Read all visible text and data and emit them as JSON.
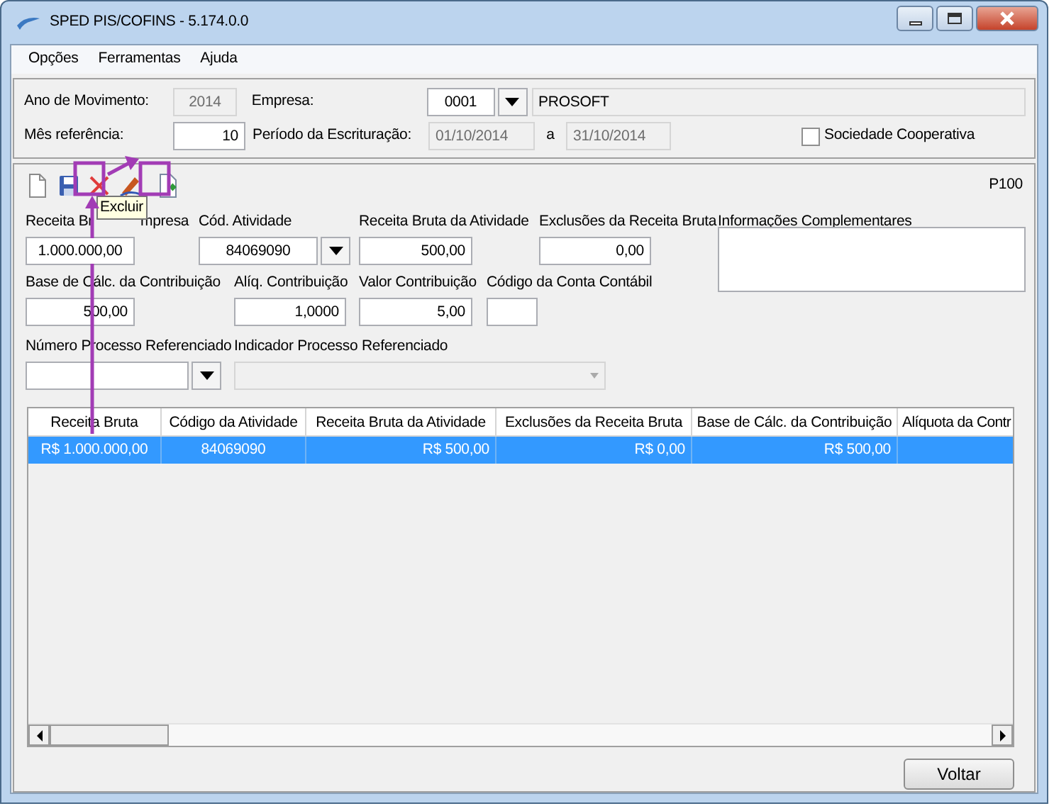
{
  "window": {
    "title": "SPED PIS/COFINS - 5.174.0.0"
  },
  "menu": [
    "Opções",
    "Ferramentas",
    "Ajuda"
  ],
  "header": {
    "ano_label": "Ano de Movimento:",
    "ano": "2014",
    "empresa_label": "Empresa:",
    "empresa_code": "0001",
    "empresa_name": "PROSOFT",
    "mes_label": "Mês referência:",
    "mes": "10",
    "periodo_label": "Período da Escrituração:",
    "periodo_inicio": "01/10/2014",
    "periodo_sep": "a",
    "periodo_fim": "31/10/2014",
    "cooperativa": {
      "label": "Sociedade Cooperativa",
      "checked": false
    }
  },
  "toolbar": {
    "register": "P100",
    "tooltip": "Excluir"
  },
  "form": {
    "rows": [
      [
        {
          "kind": "text",
          "label": "Receita Br",
          "label_tail": "mpresa",
          "value": "1.000.000,00"
        },
        {
          "kind": "combo",
          "label": "Cód. Atividade",
          "value": "84069090"
        },
        {
          "kind": "text",
          "label": "Receita Bruta da Atividade",
          "value": "500,00"
        },
        {
          "kind": "text",
          "label": "Exclusões da Receita Bruta",
          "value": "0,00"
        }
      ],
      [
        {
          "kind": "text",
          "label": "Base de Cálc. da Contribuição",
          "value": "500,00"
        },
        {
          "kind": "text",
          "label": "Alíq. Contribuição",
          "value": "1,0000"
        },
        {
          "kind": "text",
          "label": "Valor Contribuição",
          "value": "5,00"
        },
        {
          "kind": "text",
          "label": "Código da Conta Contábil"
        }
      ],
      [
        {
          "kind": "combo",
          "label": "Número Processo Referenciado"
        },
        {
          "kind": "combo",
          "label": "Indicador Processo Referenciado",
          "disabled": true
        }
      ]
    ],
    "memo": {
      "label": "Informações Complementares"
    }
  },
  "table": {
    "columns": [
      "Receita Bruta",
      "Código da Atividade",
      "Receita Bruta da Atividade",
      "Exclusões da Receita Bruta",
      "Base de Cálc. da Contribuição",
      "Alíquota da Contr"
    ],
    "rows": [
      {
        "cells": [
          "R$ 1.000.000,00",
          "84069090",
          "R$ 500,00",
          "R$ 0,00",
          "R$ 500,00"
        ],
        "selected": true
      }
    ]
  },
  "footer": {
    "button": "Voltar"
  }
}
